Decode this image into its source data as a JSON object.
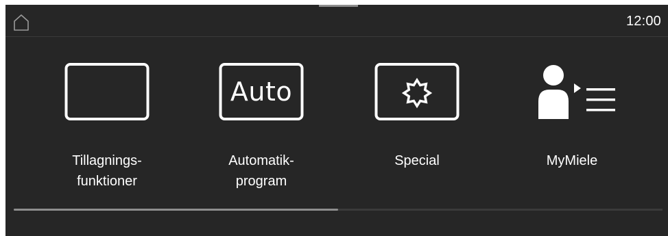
{
  "status_bar": {
    "home_icon": "home-icon",
    "time": "12:00"
  },
  "tiles": [
    {
      "icon": "square-frame-icon",
      "label_line1": "Tillagnings-",
      "label_line2": "funktioner"
    },
    {
      "icon": "auto-icon",
      "icon_text": "Auto",
      "label_line1": "Automatik-",
      "label_line2": "program"
    },
    {
      "icon": "star-frame-icon",
      "label_line1": "Special",
      "label_line2": ""
    },
    {
      "icon": "user-list-icon",
      "label_line1": "MyMiele",
      "label_line2": ""
    }
  ],
  "scrollbar": {
    "position": 0.0,
    "visible_fraction": 0.5
  },
  "colors": {
    "background": "#262626",
    "foreground": "#ffffff",
    "divider": "#3a3a3a",
    "scroll_thumb": "#8e8e8e"
  }
}
